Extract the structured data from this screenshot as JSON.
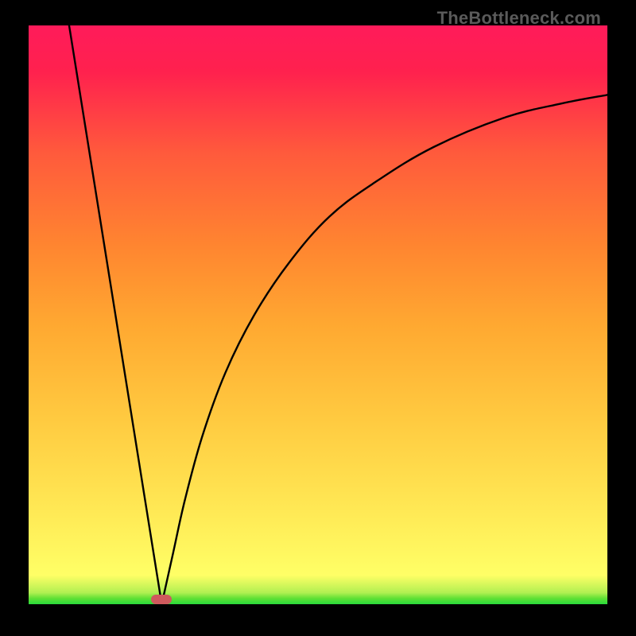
{
  "watermark": "TheBottleneck.com",
  "chart_data": {
    "type": "line",
    "title": "",
    "xlabel": "",
    "ylabel": "",
    "xlim": [
      0,
      100
    ],
    "ylim": [
      0,
      100
    ],
    "grid": false,
    "annotations": [
      {
        "kind": "marker",
        "x": 23,
        "y": 99.2,
        "shape": "pill",
        "color": "#cf5a5d"
      },
      {
        "kind": "watermark",
        "text": "TheBottleneck.com",
        "position": "top-right",
        "color": "#5a5a5a"
      }
    ],
    "background_gradient": {
      "direction": "bottom-to-top",
      "stops": [
        {
          "t": 0.0,
          "color": "#29db3c"
        },
        {
          "t": 0.02,
          "color": "#b1f052"
        },
        {
          "t": 0.05,
          "color": "#ffff66"
        },
        {
          "t": 0.32,
          "color": "#ffca40"
        },
        {
          "t": 0.62,
          "color": "#ff8530"
        },
        {
          "t": 0.92,
          "color": "#ff214e"
        },
        {
          "t": 1.0,
          "color": "#ff1b5a"
        }
      ]
    },
    "series": [
      {
        "name": "left-branch",
        "x": [
          7,
          9,
          11,
          13,
          15,
          17,
          19,
          21,
          23
        ],
        "values": [
          0,
          12.5,
          25,
          37.5,
          50,
          62.5,
          75,
          87.5,
          100
        ]
      },
      {
        "name": "right-branch",
        "x": [
          23,
          25,
          27,
          30,
          34,
          39,
          45,
          52,
          60,
          70,
          82,
          92,
          100
        ],
        "values": [
          100,
          91,
          82,
          71,
          60,
          50,
          41,
          33,
          27,
          21,
          16,
          13.5,
          12
        ]
      }
    ],
    "comment": "y-axis is bottleneck severity in percent (0 at top, 100 at bottom). x-axis is relative hardware capability (arbitrary 0–100). Minimum bottleneck at x≈23."
  }
}
